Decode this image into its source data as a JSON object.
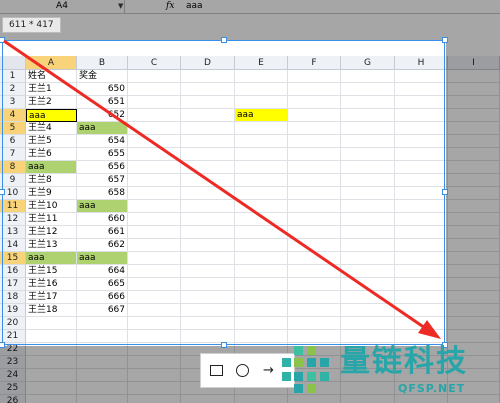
{
  "formula_bar": {
    "name_box": "A4",
    "fx_label": "fx",
    "value": "aaa"
  },
  "capture": {
    "size_label": "611 * 417"
  },
  "sheet": {
    "columns": [
      "A",
      "B",
      "C",
      "D",
      "E",
      "F",
      "G",
      "H",
      "I"
    ],
    "rows": [
      {
        "n": "1",
        "a": "姓名",
        "b": "奖金"
      },
      {
        "n": "2",
        "a": "王兰1",
        "b": "650"
      },
      {
        "n": "3",
        "a": "王兰2",
        "b": "651"
      },
      {
        "n": "4",
        "a": "aaa",
        "b": "652"
      },
      {
        "n": "5",
        "a": "王兰4",
        "b": "aaa"
      },
      {
        "n": "6",
        "a": "王兰5",
        "b": "654"
      },
      {
        "n": "7",
        "a": "王兰6",
        "b": "655"
      },
      {
        "n": "8",
        "a": "aaa",
        "b": "656"
      },
      {
        "n": "9",
        "a": "王兰8",
        "b": "657"
      },
      {
        "n": "10",
        "a": "王兰9",
        "b": "658"
      },
      {
        "n": "11",
        "a": "王兰10",
        "b": "aaa"
      },
      {
        "n": "12",
        "a": "王兰11",
        "b": "660"
      },
      {
        "n": "13",
        "a": "王兰12",
        "b": "661"
      },
      {
        "n": "14",
        "a": "王兰13",
        "b": "662"
      },
      {
        "n": "15",
        "a": "aaa",
        "b": "aaa"
      },
      {
        "n": "16",
        "a": "王兰15",
        "b": "664"
      },
      {
        "n": "17",
        "a": "王兰16",
        "b": "665"
      },
      {
        "n": "18",
        "a": "王兰17",
        "b": "666"
      },
      {
        "n": "19",
        "a": "王兰18",
        "b": "667"
      },
      {
        "n": "20",
        "a": "",
        "b": ""
      },
      {
        "n": "21",
        "a": "",
        "b": ""
      },
      {
        "n": "22",
        "a": "",
        "b": ""
      },
      {
        "n": "23",
        "a": "",
        "b": ""
      },
      {
        "n": "24",
        "a": "",
        "b": ""
      },
      {
        "n": "25",
        "a": "",
        "b": ""
      },
      {
        "n": "26",
        "a": "",
        "b": ""
      }
    ],
    "e4_value": "aaa",
    "highlight_yellow": "#ffff00",
    "highlight_green": "#aed26f"
  },
  "toolbar": {
    "tools": [
      "rectangle-icon",
      "circle-icon",
      "arrow-icon"
    ]
  },
  "watermark": {
    "title": "量链科技",
    "subtitle": "QFSP.NET",
    "color": "#27a5a8"
  },
  "annotation": {
    "arrow_color": "#ee2a24"
  }
}
